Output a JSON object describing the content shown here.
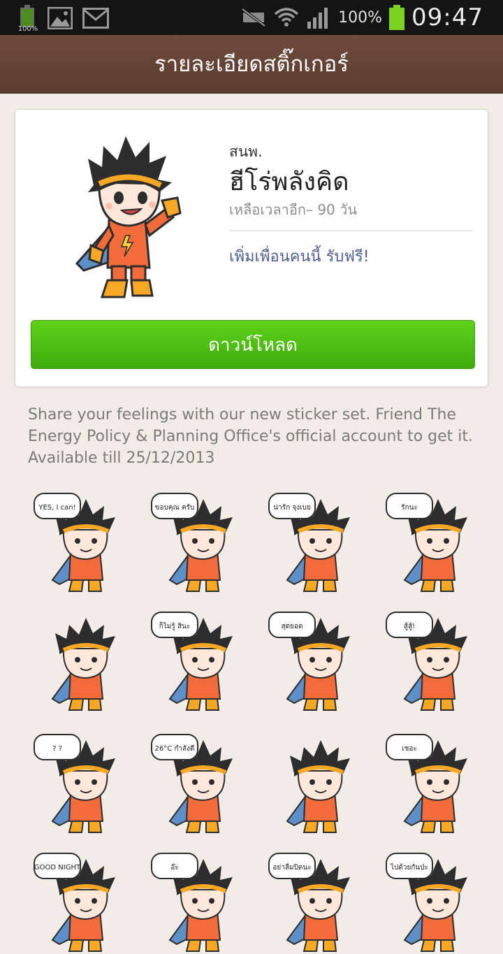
{
  "status_bar": {
    "small_battery_label": "100%",
    "battery_percent": "100%",
    "time": "09:47",
    "icons": [
      "battery-notification-icon",
      "image-notification-icon",
      "mail-icon",
      "mute-icon",
      "wifi-icon",
      "signal-icon",
      "battery-icon"
    ]
  },
  "header": {
    "title": "รายละเอียดสติ๊กเกอร์"
  },
  "sticker_pack": {
    "publisher": "สนพ.",
    "name": "ฮีโร่พลังคิด",
    "remaining": "เหลือเวลาอีก– 90 วัน",
    "add_friend": "เพิ่มเพื่อนคนนี้ รับฟรี!",
    "download_label": "ดาวน์โหลด"
  },
  "description": "Share your feelings with our new sticker set. Friend The Energy Policy & Planning Office's official account to get it. Available till 25/12/2013",
  "stickers": [
    {
      "id": "yes",
      "bubble": "YES, I can!"
    },
    {
      "id": "thanks",
      "bubble": "ขอบคุณ ครับ"
    },
    {
      "id": "cute",
      "bubble": "น่ารัก จุงเบย"
    },
    {
      "id": "love",
      "bubble": "รักนะ"
    },
    {
      "id": "laugh",
      "bubble": ""
    },
    {
      "id": "dunno",
      "bubble": "ก็ไม่รู้ สินะ"
    },
    {
      "id": "great",
      "bubble": "สุดยอด"
    },
    {
      "id": "fight",
      "bubble": "สู้สู้!"
    },
    {
      "id": "confused",
      "bubble": "? ?"
    },
    {
      "id": "ac",
      "bubble": "26°C กำลังดี"
    },
    {
      "id": "cry",
      "bubble": ""
    },
    {
      "id": "hmm",
      "bubble": "เชอะ"
    },
    {
      "id": "goodnight",
      "bubble": "GOOD NIGHT"
    },
    {
      "id": "wait",
      "bubble": "อ๊ะ"
    },
    {
      "id": "dontforget",
      "bubble": "อย่าลืมปิดนะ"
    },
    {
      "id": "together",
      "bubble": "ไปด้วยกันป่ะ"
    }
  ],
  "colors": {
    "header_bg": "#5d3e31",
    "page_bg": "#f1ece5",
    "download_green": "#4bbd12",
    "hero_orange": "#f26b3a",
    "cape_blue": "#5d8fc9",
    "link_color": "#4f5f8f"
  }
}
